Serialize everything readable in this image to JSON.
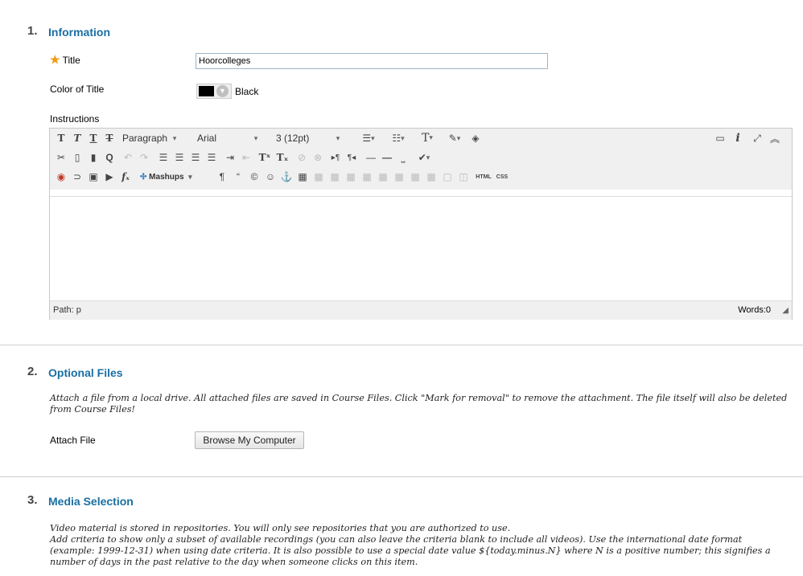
{
  "sections": [
    {
      "number": "1.",
      "title": "Information"
    },
    {
      "number": "2.",
      "title": "Optional Files"
    },
    {
      "number": "3.",
      "title": "Media Selection"
    }
  ],
  "information": {
    "title_required_mark": "★",
    "title_label": "Title",
    "title_value": "Hoorcolleges",
    "color_label": "Color of Title",
    "color_value": "Black",
    "color_hex": "#000000",
    "instructions_label": "Instructions"
  },
  "editor": {
    "paragraph_format": "Paragraph",
    "font_family": "Arial",
    "font_size": "3 (12pt)",
    "mashups_label": "Mashups",
    "html_label": "HTML",
    "css_label": "CSS",
    "path_label": "Path: p",
    "word_count": "Words:0"
  },
  "optional_files": {
    "description": "Attach a file from a local drive. All attached files are saved in Course Files. Click \"Mark for removal\" to remove the attachment. The file itself will also be deleted from Course Files!",
    "attach_label": "Attach File",
    "browse_button": "Browse My Computer"
  },
  "media_selection": {
    "line1": "Video material is stored in repositories. You will only see repositories that you are authorized to use.",
    "line2": "Add criteria to show only a subset of available recordings (you can also leave the criteria blank to include all videos). Use the international date format",
    "line3": "(example: 1999-12-31) when using date criteria. It is also possible to use a special date value ${today.minus.N} where N is a positive number; this signifies a",
    "line4": "number of days in the past relative to the day when someone clicks on this item."
  },
  "colors": {
    "accent": "#1a6fa3",
    "required_star": "#f29b12",
    "toolbar_bg": "#f0f0f0"
  }
}
